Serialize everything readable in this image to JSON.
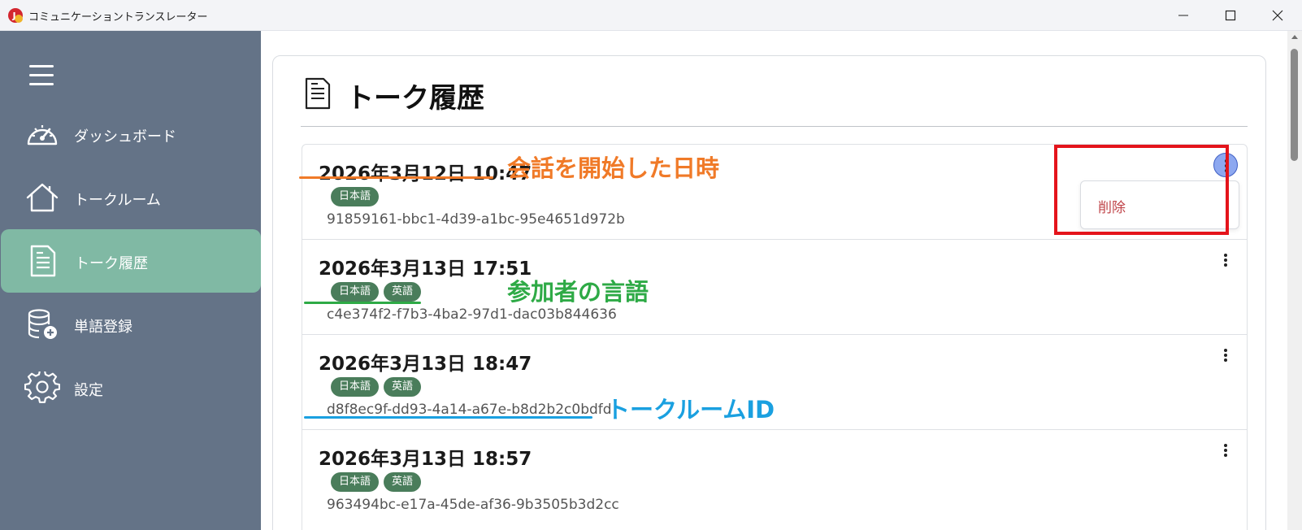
{
  "window": {
    "title": "コミュニケーショントランスレーター",
    "logo_letter": "J",
    "icon_minimize": "minimize-icon",
    "icon_maximize": "maximize-icon",
    "icon_close": "close-icon"
  },
  "sidebar": {
    "menu_icon": "hamburger-menu-icon",
    "items": [
      {
        "label": "ダッシュボード",
        "icon": "speedometer-icon",
        "active": false
      },
      {
        "label": "トークルーム",
        "icon": "house-icon",
        "active": false
      },
      {
        "label": "トーク履歴",
        "icon": "document-icon",
        "active": true
      },
      {
        "label": "単語登録",
        "icon": "database-add-icon",
        "active": false
      },
      {
        "label": "設定",
        "icon": "gear-icon",
        "active": false
      }
    ]
  },
  "page": {
    "title": "トーク履歴",
    "title_icon": "document-icon"
  },
  "history": [
    {
      "datetime": "2026年3月12日 10:47",
      "languages": [
        "日本語"
      ],
      "id": "91859161-bbc1-4d39-a1bc-95e4651d972b",
      "menu_open": true
    },
    {
      "datetime": "2026年3月13日 17:51",
      "languages": [
        "日本語",
        "英語"
      ],
      "id": "c4e374f2-f7b3-4ba2-97d1-dac03b844636",
      "menu_open": false
    },
    {
      "datetime": "2026年3月13日 18:47",
      "languages": [
        "日本語",
        "英語"
      ],
      "id": "d8f8ec9f-dd93-4a14-a67e-b8d2b2c0bdfd",
      "menu_open": false
    },
    {
      "datetime": "2026年3月13日 18:57",
      "languages": [
        "日本語",
        "英語"
      ],
      "id": "963494bc-e17a-45de-af36-9b3505b3d2cc",
      "menu_open": false
    }
  ],
  "row_menu": {
    "delete_label": "削除",
    "icon": "more-vertical-icon"
  },
  "annotations": {
    "start_datetime": {
      "text": "会話を開始した日時",
      "color": "#f07a28"
    },
    "participant_languages": {
      "text": "参加者の言語",
      "color": "#2eaa46"
    },
    "talk_room_id": {
      "text": "トークルームID",
      "color": "#1aa0e0"
    },
    "highlight_box_color": "#e4141b"
  },
  "colors": {
    "sidebar_bg": "#647387",
    "sidebar_active": "#80b9a4",
    "badge_bg": "#4a7d5b",
    "delete_text": "#c0454a"
  }
}
